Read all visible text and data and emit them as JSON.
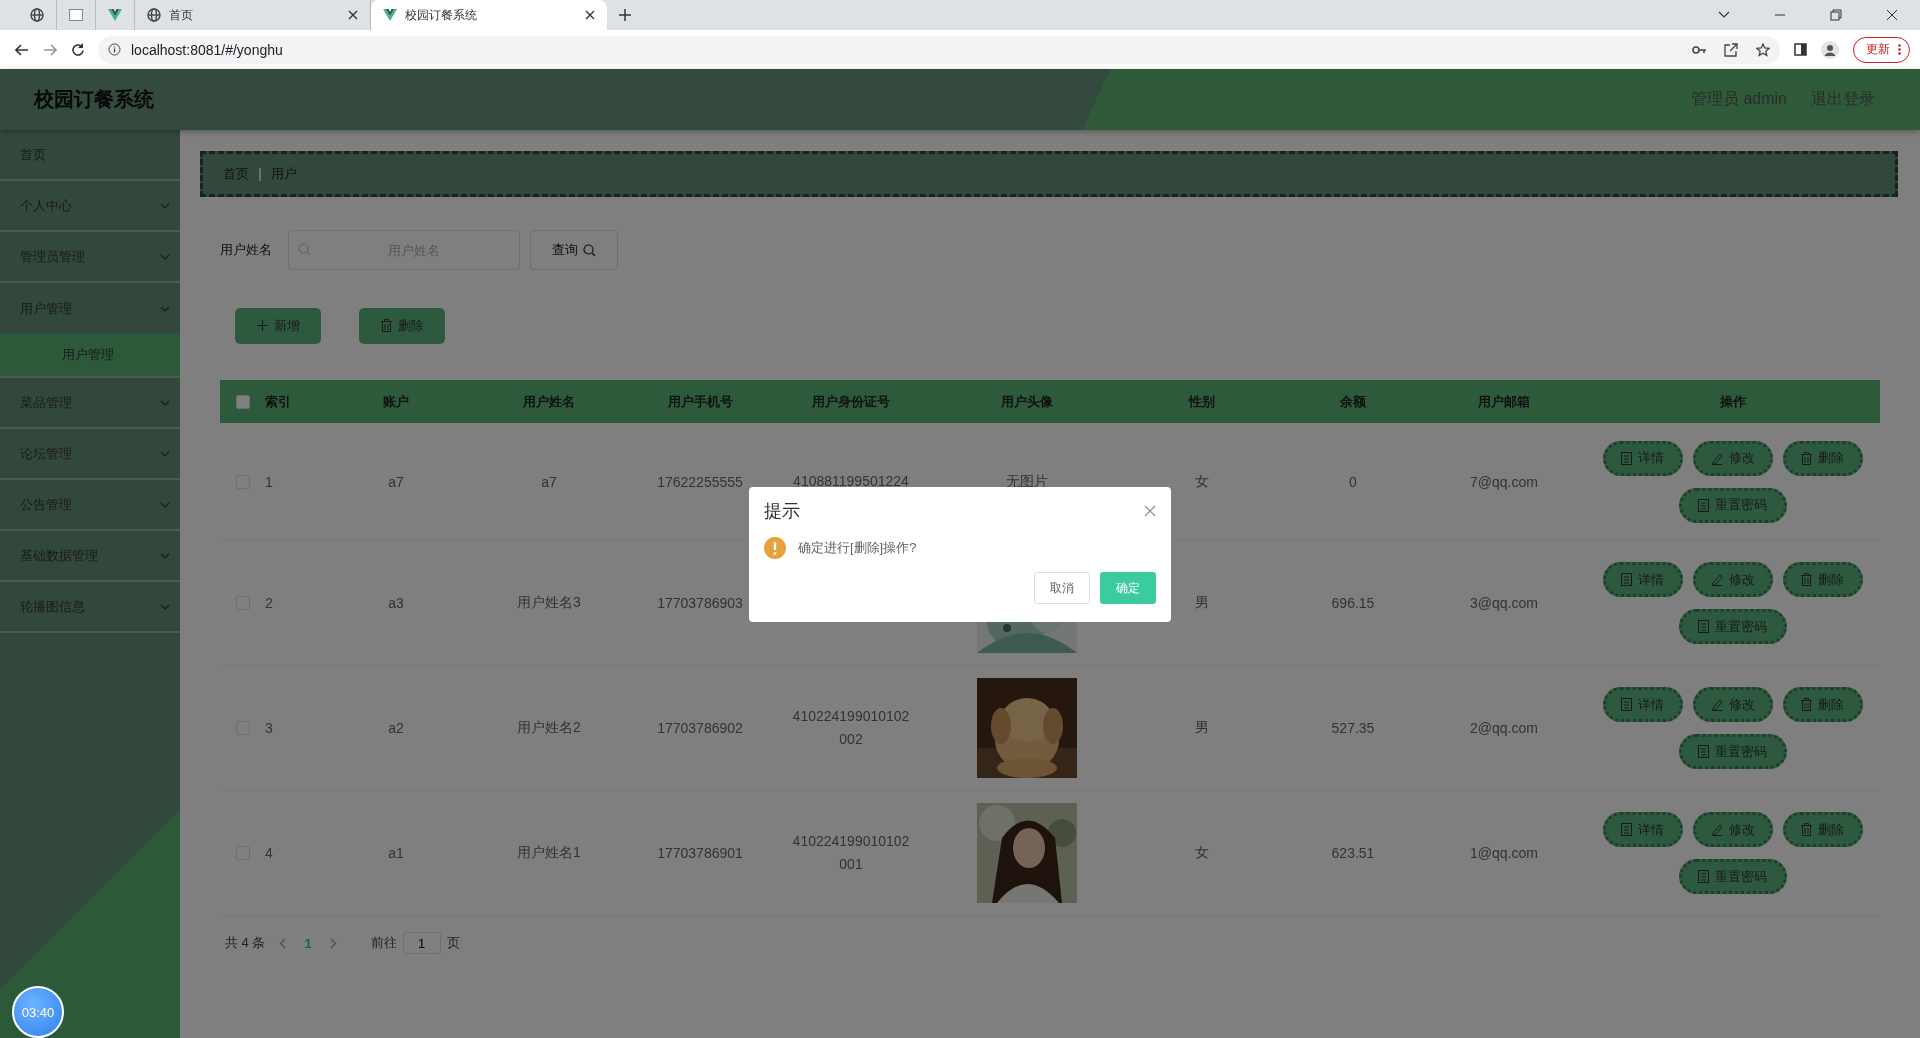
{
  "browser": {
    "tabs": [
      {
        "kind": "globe",
        "selected": false
      },
      {
        "kind": "blank",
        "selected": false
      },
      {
        "kind": "vue",
        "selected": false
      },
      {
        "kind": "globe",
        "label": "首页",
        "selected": false
      },
      {
        "kind": "vue",
        "label": "校园订餐系统",
        "selected": true
      }
    ],
    "address": "localhost:8081/#/yonghu",
    "update_button": "更新"
  },
  "header": {
    "title": "校园订餐系统",
    "user": "管理员 admin",
    "logout": "退出登录"
  },
  "sidebar": {
    "items": [
      {
        "kind": "link",
        "label": "首页"
      },
      {
        "kind": "menu",
        "label": "个人中心",
        "expanded": false
      },
      {
        "kind": "menu",
        "label": "管理员管理",
        "expanded": false
      },
      {
        "kind": "menu",
        "label": "用户管理",
        "expanded": true,
        "children": [
          {
            "label": "用户管理",
            "selected": true
          }
        ]
      },
      {
        "kind": "menu",
        "label": "菜品管理",
        "expanded": false
      },
      {
        "kind": "menu",
        "label": "论坛管理",
        "expanded": false
      },
      {
        "kind": "menu",
        "label": "公告管理",
        "expanded": false
      },
      {
        "kind": "menu",
        "label": "基础数据管理",
        "expanded": false
      },
      {
        "kind": "menu",
        "label": "轮播图信息",
        "expanded": false
      }
    ]
  },
  "breadcrumb": [
    "首页",
    "用户"
  ],
  "search": {
    "label": "用户姓名",
    "placeholder": "用户姓名",
    "button": "查询"
  },
  "actions": [
    {
      "kind": "add",
      "label": "新增"
    },
    {
      "kind": "delete",
      "label": "删除"
    }
  ],
  "table": {
    "select_all_checked": false,
    "columns": [
      "索引",
      "账户",
      "用户姓名",
      "用户手机号",
      "用户身份证号",
      "用户头像",
      "性别",
      "余额",
      "用户邮箱",
      "操作"
    ],
    "rows": [
      {
        "checked": false,
        "index": "1",
        "account": "a7",
        "name": "a7",
        "phone": "17622255555",
        "id_number": "410881199501224",
        "avatar": {
          "kind": "text",
          "text": "无图片"
        },
        "sex": "女",
        "balance": "0",
        "email": "7@qq.com",
        "actions": [
          {
            "kind": "detail",
            "label": "详情"
          },
          {
            "kind": "edit",
            "label": "修改"
          },
          {
            "kind": "delete",
            "label": "删除"
          },
          {
            "kind": "reset",
            "label": "重置密码"
          }
        ]
      },
      {
        "checked": false,
        "index": "2",
        "account": "a3",
        "name": "用户姓名3",
        "phone": "17703786903",
        "avatar": {
          "kind": "picture"
        },
        "sex": "男",
        "balance": "696.15",
        "email": "3@qq.com",
        "actions": [
          {
            "kind": "detail",
            "label": "详情"
          },
          {
            "kind": "edit",
            "label": "修改"
          },
          {
            "kind": "delete",
            "label": "删除"
          },
          {
            "kind": "reset",
            "label": "重置密码"
          }
        ]
      },
      {
        "checked": false,
        "index": "3",
        "account": "a2",
        "name": "用户姓名2",
        "phone": "17703786902",
        "id_number": "410224199010102002",
        "avatar": {
          "kind": "picture"
        },
        "sex": "男",
        "balance": "527.35",
        "email": "2@qq.com",
        "actions": [
          {
            "kind": "detail",
            "label": "详情"
          },
          {
            "kind": "edit",
            "label": "修改"
          },
          {
            "kind": "delete",
            "label": "删除"
          },
          {
            "kind": "reset",
            "label": "重置密码"
          }
        ]
      },
      {
        "checked": false,
        "index": "4",
        "account": "a1",
        "name": "用户姓名1",
        "phone": "17703786901",
        "id_number": "410224199010102001",
        "avatar": {
          "kind": "picture"
        },
        "sex": "女",
        "balance": "623.51",
        "email": "1@qq.com",
        "actions": [
          {
            "kind": "detail",
            "label": "详情"
          },
          {
            "kind": "edit",
            "label": "修改"
          },
          {
            "kind": "delete",
            "label": "删除"
          },
          {
            "kind": "reset",
            "label": "重置密码"
          }
        ]
      }
    ]
  },
  "pagination": {
    "total": "共 4 条",
    "pages": [
      {
        "label": "1",
        "selected": true
      }
    ],
    "goto": "前往",
    "page_input": "1",
    "page_suffix": "页"
  },
  "dialog": {
    "title": "提示",
    "message": "确定进行[删除]操作?",
    "cancel": "取消",
    "confirm": "确定"
  },
  "recorder": {
    "time": "03:40"
  }
}
